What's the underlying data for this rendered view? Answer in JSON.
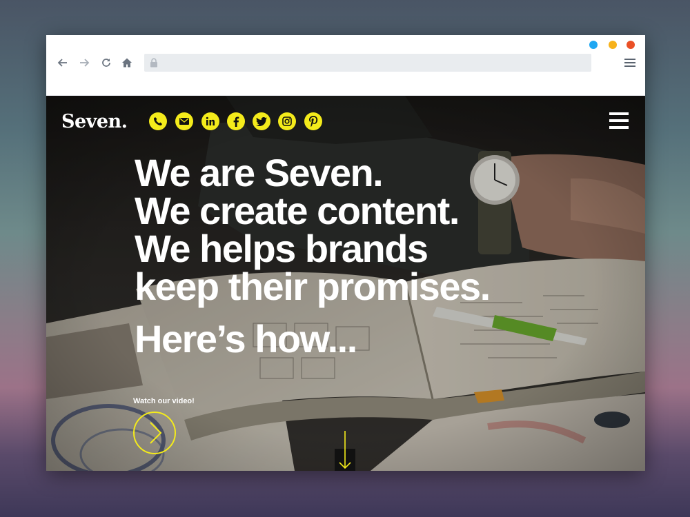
{
  "browser": {
    "traffic_lights": [
      "#1fa7f2",
      "#f7b21b",
      "#ea5026"
    ],
    "nav_icons": [
      "back-arrow-icon",
      "forward-arrow-icon",
      "reload-icon",
      "home-icon"
    ],
    "address_value": "",
    "menu_icon": "hamburger-icon"
  },
  "site": {
    "logo": "Seven.",
    "accent": "#f4eb1b",
    "social_icons": [
      "phone-icon",
      "mail-icon",
      "linkedin-icon",
      "facebook-icon",
      "twitter-icon",
      "instagram-icon",
      "pinterest-icon"
    ],
    "headline_lines": [
      "We are Seven.",
      "We create content.",
      "We helps brands",
      "keep their promises."
    ],
    "subheadline": "Here’s how...",
    "video_label": "Watch our video!"
  }
}
